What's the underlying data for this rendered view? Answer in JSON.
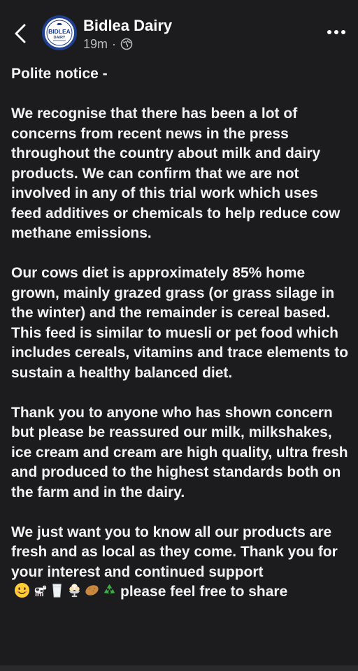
{
  "header": {
    "page_name": "Bidlea Dairy",
    "time": "19m",
    "separator": "·",
    "privacy_icon": "globe-icon",
    "back_icon": "chevron-left-icon",
    "more_icon": "more-horizontal-icon",
    "logo_text": "BIDLEA",
    "logo_subtext": "DAIRY"
  },
  "post": {
    "paragraphs": [
      "Polite notice -",
      "We recognise that there has been a lot of concerns from recent news in the press throughout the country about milk and dairy products. We can confirm that we are not involved in any of this trial work which uses feed additives or chemicals to help reduce cow methane emissions.",
      "Our cows diet is approximately 85% home grown, mainly grazed grass (or grass silage in the winter) and the remainder is cereal based. This feed is similar to muesli or pet food which includes cereals, vitamins and trace elements to sustain a healthy balanced diet.",
      "Thank you to anyone who has shown concern but please be reassured our milk, milkshakes, ice cream and cream are high quality, ultra fresh and produced to the highest standards both on the farm and in the dairy."
    ],
    "last_paragraph_start": "We just want you to know all our products are fresh and as local as they come. Thank you for your interest and continued support",
    "last_paragraph_end": "please feel free to share",
    "emojis": [
      "smiling-face-emoji",
      "cow-emoji",
      "milk-glass-emoji",
      "ice-cream-emoji",
      "potato-emoji",
      "recycle-emoji"
    ]
  },
  "colors": {
    "background": "#1c1c1e",
    "text": "#f4f4f4",
    "meta_text": "#b8bbbf",
    "logo_ring": "#1f3f8f"
  }
}
